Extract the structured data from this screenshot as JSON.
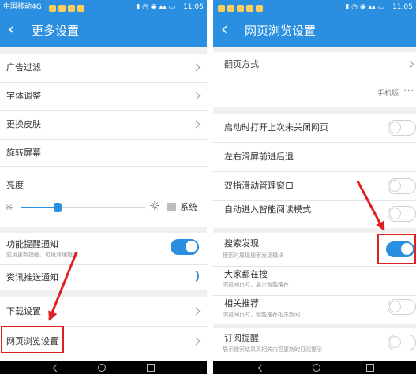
{
  "left": {
    "status": {
      "carrier": "中国移动4G",
      "time": "11:05"
    },
    "title": "更多设置",
    "items": {
      "ad_filter": "广告过滤",
      "font_size": "字体调整",
      "change_skin": "更换皮肤",
      "rotate_screen": "旋转屏幕",
      "brightness": "亮度",
      "system": "系统",
      "feature_notify": "功能提醒通知",
      "feature_notify_sub": "应用更新提醒、垃圾清理提醒",
      "news_push": "资讯推送通知",
      "download_settings": "下载设置",
      "web_browse_settings": "网页浏览设置"
    },
    "brightness_level": 0.3,
    "system_checked": false,
    "feature_notify_on": true
  },
  "right": {
    "status": {
      "time": "11:05"
    },
    "title": "网页浏览设置",
    "items": {
      "page_turn": "翻页方式",
      "version": "手机版",
      "restore_tabs": "启动时打开上次未关闭网页",
      "swipe_nav": "左右滑屏前进后退",
      "two_finger": "双指滑动管理窗口",
      "smart_read": "自动进入智能阅读模式",
      "search_discover": "搜索发现",
      "search_discover_sub": "搜索时展现搜索发现模块",
      "everyone_search": "大家都在搜",
      "everyone_search_sub": "浏览网页时，展示智能推荐",
      "related": "相关推荐",
      "related_sub": "浏览网页时，智能推荐相关新闻",
      "subscribe": "订阅提醒",
      "subscribe_sub": "展示搜索结果页相关内容更新的订阅提示"
    },
    "toggles": {
      "restore_tabs": false,
      "two_finger": false,
      "smart_read": false,
      "search_discover": true,
      "related": false,
      "subscribe": false
    }
  },
  "icons": [
    "back-arrow-icon",
    "chevron-right-icon",
    "sun-icon",
    "more-dots-icon",
    "nav-back-icon",
    "nav-home-icon",
    "nav-recent-icon"
  ],
  "colors": {
    "accent": "#2a8fe0",
    "annotation": "#e02020"
  }
}
